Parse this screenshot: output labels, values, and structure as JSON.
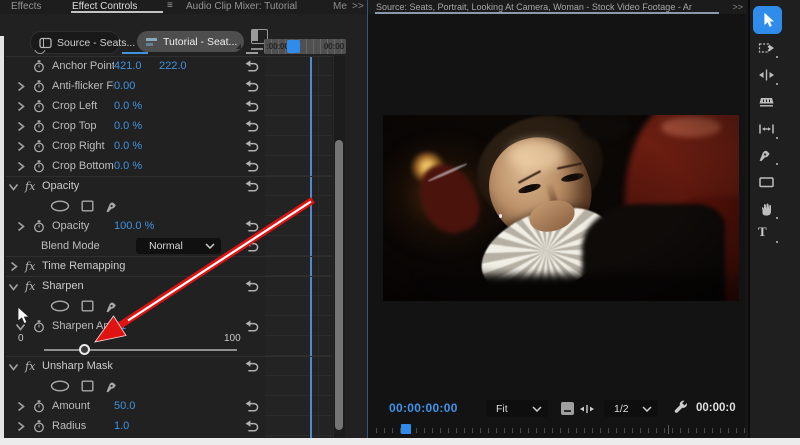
{
  "glyphs": {
    "fx": "fx",
    "menu": "≡",
    "overflow": ">>",
    "type_tool": "T"
  },
  "tabbar": {
    "tabs": [
      {
        "label": "Effects",
        "active": false
      },
      {
        "label": "Effect Controls",
        "active": true
      },
      {
        "label": "Audio Clip Mixer: Tutorial",
        "active": false
      }
    ],
    "overflow_label": "Me"
  },
  "clip_tabs": {
    "source_label": "Source - Seats...",
    "timeline_label": "Tutorial - Seat..."
  },
  "ruler": {
    "left_time": ":00:00",
    "right_time": "00:00"
  },
  "effects": [
    {
      "label": "Anchor Point",
      "value1": "421.0",
      "value2": "222.0"
    },
    {
      "label": "Anti-flicker Fil...",
      "value1": "0.00"
    },
    {
      "label": "Crop Left",
      "value1": "0.0 %"
    },
    {
      "label": "Crop Top",
      "value1": "0.0 %"
    },
    {
      "label": "Crop Right",
      "value1": "0.0 %"
    },
    {
      "label": "Crop Bottom",
      "value1": "0.0 %"
    },
    {
      "label": "Opacity"
    },
    {
      "label": "Opacity",
      "value1": "100.0 %"
    },
    {
      "label": "Blend Mode",
      "value1": "Normal"
    },
    {
      "label": "Time Remapping"
    },
    {
      "label": "Sharpen"
    },
    {
      "label": "Sharpen Amount",
      "value1": "21"
    },
    {
      "label": "Unsharp Mask"
    },
    {
      "label": "Amount",
      "value1": "50.0"
    },
    {
      "label": "Radius",
      "value1": "1.0"
    }
  ],
  "slider": {
    "min_label": "0",
    "max_label": "100",
    "value": 21
  },
  "monitor": {
    "header_title": "Source: Seats, Portrait, Looking At Camera, Woman - Stock Video Footage - Ar",
    "current_timecode": "00:00:00:00",
    "zoom_select": "Fit",
    "resolution_select": "1/2",
    "duration_timecode": "00:00:0"
  },
  "tools": [
    "selection",
    "track-select-forward",
    "ripple-edit",
    "razor",
    "slip",
    "pen",
    "rectangle",
    "hand",
    "type"
  ],
  "colors": {
    "value_blue": "#4093df",
    "playhead_blue": "#2f8ceb",
    "arrow_red": "#e01212",
    "tool_active": "#2f8ceb"
  }
}
